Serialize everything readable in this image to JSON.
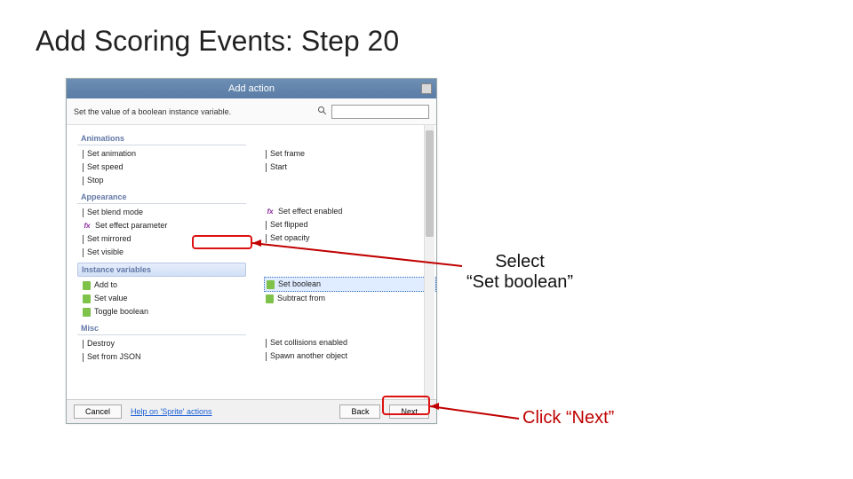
{
  "slide": {
    "title": "Add Scoring Events: Step 20"
  },
  "dialog": {
    "title": "Add action",
    "description": "Set the value of a boolean instance variable.",
    "search_placeholder": "",
    "categories": {
      "animations": {
        "label": "Animations",
        "left": [
          "Set animation",
          "Set speed",
          "Stop"
        ],
        "right": [
          "Set frame",
          "Start"
        ]
      },
      "appearance": {
        "label": "Appearance",
        "left": [
          "Set blend mode",
          "Set effect parameter",
          "Set mirrored",
          "Set visible"
        ],
        "right": [
          "Set effect enabled",
          "Set flipped",
          "Set opacity"
        ]
      },
      "instance": {
        "label": "Instance variables",
        "left": [
          "Add to",
          "Set value",
          "Toggle boolean"
        ],
        "right": [
          "Set boolean",
          "Subtract from"
        ]
      },
      "misc": {
        "label": "Misc",
        "left": [
          "Destroy",
          "Set from JSON"
        ],
        "right": [
          "Set collisions enabled",
          "Spawn another object"
        ]
      }
    },
    "buttons": {
      "cancel": "Cancel",
      "help": "Help on 'Sprite' actions",
      "back": "Back",
      "next": "Next"
    }
  },
  "annotations": {
    "select": "Select\n“Set boolean”",
    "click": "Click “Next”"
  }
}
